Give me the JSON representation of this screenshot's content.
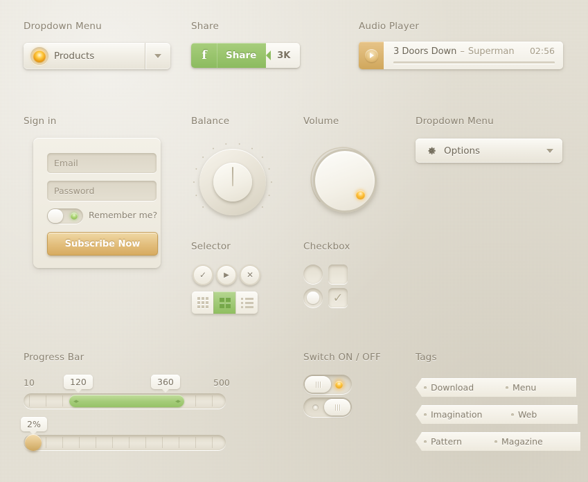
{
  "sections": {
    "dropdown_menu_1": "Dropdown Menu",
    "share": "Share",
    "audio_player": "Audio Player",
    "sign_in": "Sign in",
    "balance": "Balance",
    "volume": "Volume",
    "dropdown_menu_2": "Dropdown Menu",
    "selector": "Selector",
    "checkbox": "Checkbox",
    "progress_bar": "Progress Bar",
    "switch": "Switch ON / OFF",
    "tags": "Tags"
  },
  "dropdown_products": {
    "value": "Products",
    "icon": "led-dot-icon",
    "arrow": "chevron-down-icon"
  },
  "dropdown_options": {
    "value": "Options",
    "icon": "gear-icon",
    "arrow": "chevron-down-icon"
  },
  "share_widget": {
    "facebook_label": "f",
    "share_label": "Share",
    "count": "3K",
    "accent": "#8cbb5f"
  },
  "audio": {
    "artist": "3 Doors Down",
    "separator": "–",
    "track": "Superman",
    "time": "02:56",
    "play_icon": "play-icon"
  },
  "signin": {
    "email_placeholder": "Email",
    "password_placeholder": "Password",
    "remember_label": "Remember me?",
    "remember_state": "off",
    "submit_label": "Subscribe Now"
  },
  "knobs": {
    "balance_position": "center",
    "volume_indicator": "lower-right"
  },
  "selector": {
    "round_buttons": [
      {
        "name": "check-icon",
        "glyph": "✓"
      },
      {
        "name": "play-icon",
        "glyph": "▶"
      },
      {
        "name": "close-icon",
        "glyph": "✕"
      }
    ],
    "segments": [
      {
        "name": "grid-small-icon",
        "active": false
      },
      {
        "name": "grid-large-icon",
        "active": true
      },
      {
        "name": "list-icon",
        "active": false
      }
    ]
  },
  "checkboxes": {
    "radio_empty": "off",
    "checkbox_empty": "",
    "radio_filled": "on",
    "checkbox_checked": "✓"
  },
  "progress": {
    "range": {
      "min_label": "10",
      "max_label": "500",
      "low_value": "120",
      "high_value": "360"
    },
    "single": {
      "value_label": "2%"
    }
  },
  "switches": [
    {
      "name": "switch-off",
      "state": "off",
      "led": "amber"
    },
    {
      "name": "switch-on",
      "state": "on",
      "led": "dark"
    }
  ],
  "tags": [
    "Download",
    "Menu",
    "Imagination",
    "Web",
    "Pattern",
    "Magazine"
  ],
  "colors": {
    "background": "#e6e2d7",
    "label": "#8b8372",
    "green": "#8cbb5f",
    "amber": "#e2bd78"
  }
}
